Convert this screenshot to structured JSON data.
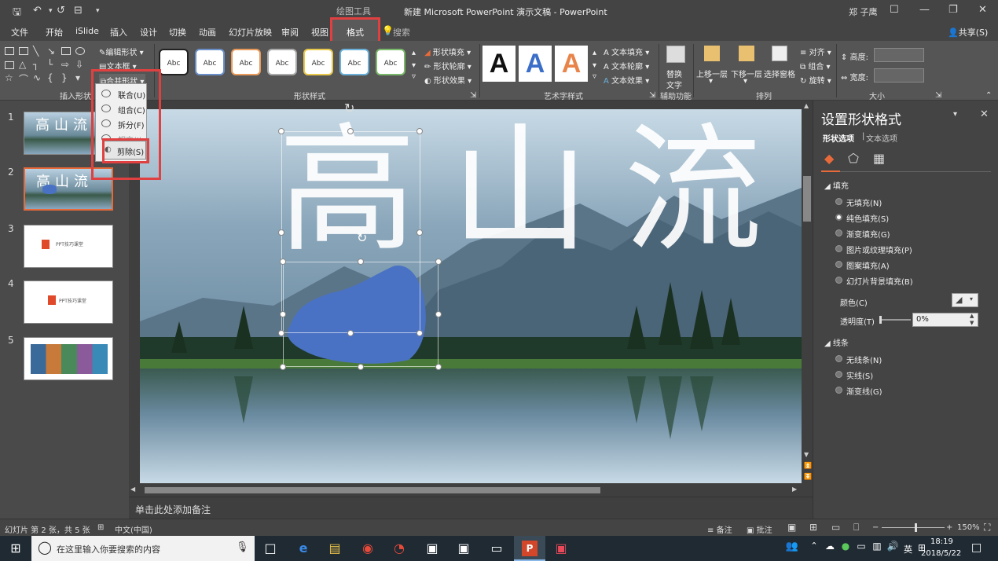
{
  "titlebar": {
    "save_icon": "save-icon",
    "drawing_tools": "绘图工具",
    "title": "新建 Microsoft PowerPoint 演示文稿 - PowerPoint",
    "user": "郑 子鹰",
    "share": "共享(S)"
  },
  "tabs": {
    "file": "文件",
    "home": "开始",
    "islide": "iSlide",
    "insert": "插入",
    "design": "设计",
    "transitions": "切换",
    "animations": "动画",
    "slideshow": "幻灯片放映",
    "review": "审阅",
    "view": "视图",
    "format": "格式",
    "search": "搜索"
  },
  "ribbon": {
    "edit_shape": "编辑形状",
    "textbox": "文本框",
    "merge_shapes": "合并形状",
    "insert_shapes_label": "插入形状",
    "shape_styles_label": "形状样式",
    "abc": "Abc",
    "shape_fill": "形状填充",
    "shape_outline": "形状轮廓",
    "shape_effects": "形状效果",
    "wordart_label": "艺术字样式",
    "wordart_letter": "A",
    "text_fill": "文本填充",
    "text_outline": "文本轮廓",
    "text_effects": "文本效果",
    "alt_text_1": "替换",
    "alt_text_2": "文字",
    "accessibility_label": "辅助功能",
    "bring_forward": "上移一层",
    "send_backward": "下移一层",
    "selection_pane": "选择窗格",
    "align": "对齐",
    "group": "组合",
    "rotate": "旋转",
    "arrange_label": "排列",
    "height": "高度:",
    "width": "宽度:",
    "size_label": "大小"
  },
  "merge_menu": {
    "union": "联合(U)",
    "combine": "组合(C)",
    "fragment": "拆分(F)",
    "intersect": "相交(I)",
    "subtract": "剪除(S)"
  },
  "slides": [
    {
      "num": "1"
    },
    {
      "num": "2"
    },
    {
      "num": "3"
    },
    {
      "num": "4"
    },
    {
      "num": "5"
    }
  ],
  "slide_text": {
    "big_chars": "高山流",
    "thumb_title": "PPT技巧课堂"
  },
  "notes": "单击此处添加备注",
  "panel": {
    "title": "设置形状格式",
    "tab_shape": "形状选项",
    "tab_text": "文本选项",
    "fill_section": "填充",
    "fill_options": [
      "无填充(N)",
      "纯色填充(S)",
      "渐变填充(G)",
      "图片或纹理填充(P)",
      "图案填充(A)",
      "幻灯片背景填充(B)"
    ],
    "color_label": "颜色(C)",
    "transparency_label": "透明度(T)",
    "transparency_value": "0%",
    "line_section": "线条",
    "line_options": [
      "无线条(N)",
      "实线(S)",
      "渐变线(G)"
    ]
  },
  "status": {
    "slide_info": "幻灯片 第 2 张，共 5 张",
    "language": "中文(中国)",
    "notes": "备注",
    "comments": "批注",
    "zoom": "150%"
  },
  "taskbar": {
    "search_placeholder": "在这里输入你要搜索的内容",
    "ime": "英",
    "time": "18:19",
    "date": "2018/5/22"
  },
  "colors": {
    "accent_red": "#e04040",
    "shape_blue": "#4a72c4"
  }
}
